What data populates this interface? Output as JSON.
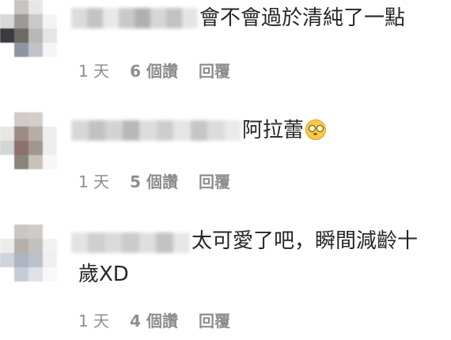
{
  "comments": [
    {
      "text": "會不會過於清純了一點",
      "time": "1 天",
      "likes": "6 個讚",
      "reply": "回覆",
      "avatar_colors": [
        "#ffffff",
        "#c9c3c0",
        "#e9e7e6",
        "#ffffff",
        "#d8d8d8",
        "#9b9a99",
        "#c9c9c9",
        "#f3f3f3",
        "#393b3f",
        "#6f6a66",
        "#b8b8b8",
        "#e5e5e5",
        "#ffffff",
        "#8d95a3",
        "#bfc3c9",
        "#f5f5f5"
      ],
      "name_colors": [
        "#d9d9d9",
        "#bdbdbd",
        "#e7e7e7",
        "#c4c4c4",
        "#a8a8a8",
        "#d2d2d2",
        "#bcbcbc",
        "#e2e2e2"
      ]
    },
    {
      "text": "阿拉蕾",
      "emoji": "face-with-monocle-emoji",
      "time": "1 天",
      "likes": "5 個讚",
      "reply": "回覆",
      "avatar_colors": [
        "#ffffff",
        "#d0cbc8",
        "#d4cdc9",
        "#ffffff",
        "#e8e6e5",
        "#9d8c86",
        "#b9adaa",
        "#efeeed",
        "#d3d5d8",
        "#8c716c",
        "#a39591",
        "#eeeeee",
        "#ffffff",
        "#8a8479",
        "#c8c2bb",
        "#f7f7f7"
      ],
      "name_colors": [
        "#d3d3d3",
        "#bcbcbc",
        "#cfcfcf",
        "#b0b0b0",
        "#dadada",
        "#c8c8c8",
        "#e3e3e3",
        "#c0c0c0",
        "#d9d9d9",
        "#e8e8e8"
      ]
    },
    {
      "text_line1": "太可愛了吧，瞬間減齡十",
      "text_line2": "歲XD",
      "time": "1 天",
      "likes": "4 個讚",
      "reply": "回覆",
      "avatar_colors": [
        "#ffffff",
        "#c9c6c5",
        "#cfcbc8",
        "#ffffff",
        "#ececec",
        "#b6b0ad",
        "#c4c0bc",
        "#f1f1f1",
        "#cfd3da",
        "#aeb4c2",
        "#bcc0c8",
        "#efefef",
        "#ffffff",
        "#c7cbd6",
        "#dfe1e6",
        "#f8f8f8"
      ],
      "name_colors": [
        "#e0e0e0",
        "#cacaca",
        "#d7d7d7",
        "#c6c6c6",
        "#dcdcdc",
        "#bdbdbd",
        "#e5e5e5"
      ]
    }
  ]
}
